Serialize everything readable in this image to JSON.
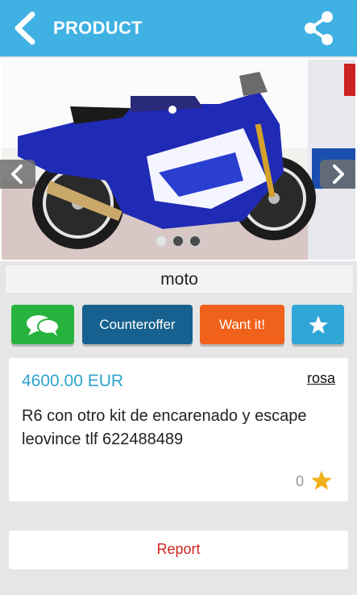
{
  "header": {
    "title": "PRODUCT",
    "background_color": "#3fb1e3",
    "back_icon": "chevron-left-icon",
    "share_icon": "share-icon"
  },
  "gallery": {
    "image_alt": "blue sport motorcycle",
    "dots": 3,
    "active_dot": 1
  },
  "product": {
    "name": "moto",
    "price": "4600.00 EUR",
    "seller": "rosa",
    "description": "R6 con otro kit de encarenado y escape leovince tlf 622488489",
    "likes": "0"
  },
  "actions": {
    "chat_icon": "chat-bubbles-icon",
    "counteroffer_label": "Counteroffer",
    "want_label": "Want it!",
    "favorite_icon": "star-icon",
    "chat_color": "#27b33e",
    "counteroffer_color": "#16618f",
    "want_color": "#f0621b",
    "favorite_color": "#2fa6d6"
  },
  "report": {
    "label": "Report",
    "color": "#d2231e"
  }
}
